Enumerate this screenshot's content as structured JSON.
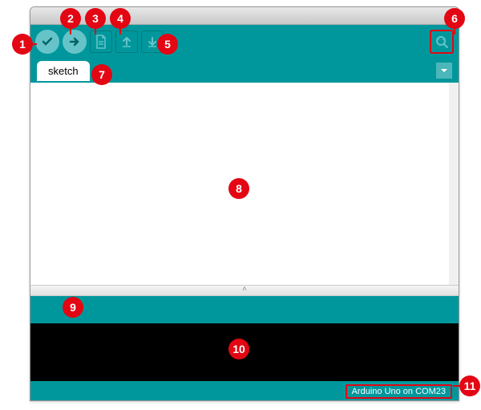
{
  "tab_label": "sketch",
  "footer": {
    "board_info": "Arduino Uno on COM23"
  },
  "icons": {
    "verify": "check-icon",
    "upload": "arrow-right-icon",
    "new": "file-icon",
    "open": "arrow-up-icon",
    "save": "arrow-down-icon",
    "serial": "magnifier-icon",
    "tabmenu": "triangle-down-icon"
  },
  "callouts": [
    "1",
    "2",
    "3",
    "4",
    "5",
    "6",
    "7",
    "8",
    "9",
    "10",
    "11"
  ]
}
